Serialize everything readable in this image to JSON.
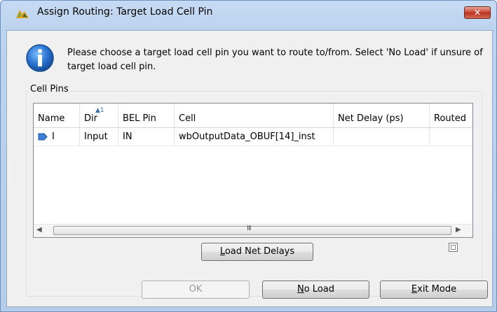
{
  "window": {
    "title": "Assign Routing: Target Load Cell Pin",
    "close_label": "✕"
  },
  "message": "Please choose a target load cell pin you want to route to/from. Select 'No Load' if unsure of target load cell pin.",
  "group_label": "Cell Pins",
  "table": {
    "columns": [
      "Name",
      "Dir",
      "BEL Pin",
      "Cell",
      "Net Delay (ps)",
      "Routed"
    ],
    "sort_indicator": "1",
    "rows": [
      {
        "name": "I",
        "dir": "Input",
        "bel_pin": "IN",
        "cell": "wbOutputData_OBUF[14]_inst",
        "net_delay": "",
        "routed": ""
      }
    ]
  },
  "buttons": {
    "load_net_delays_hot": "L",
    "load_net_delays_rest": "oad Net Delays",
    "ok": "OK",
    "no_load_hot": "N",
    "no_load_rest": "o Load",
    "exit_mode_hot": "E",
    "exit_mode_rest": "xit Mode"
  },
  "scrollbar": {
    "grip": "III"
  },
  "colors": {
    "title_bar": "#bcd3ef",
    "close": "#c8412d",
    "pin_arrow": "#3d7fd6"
  }
}
